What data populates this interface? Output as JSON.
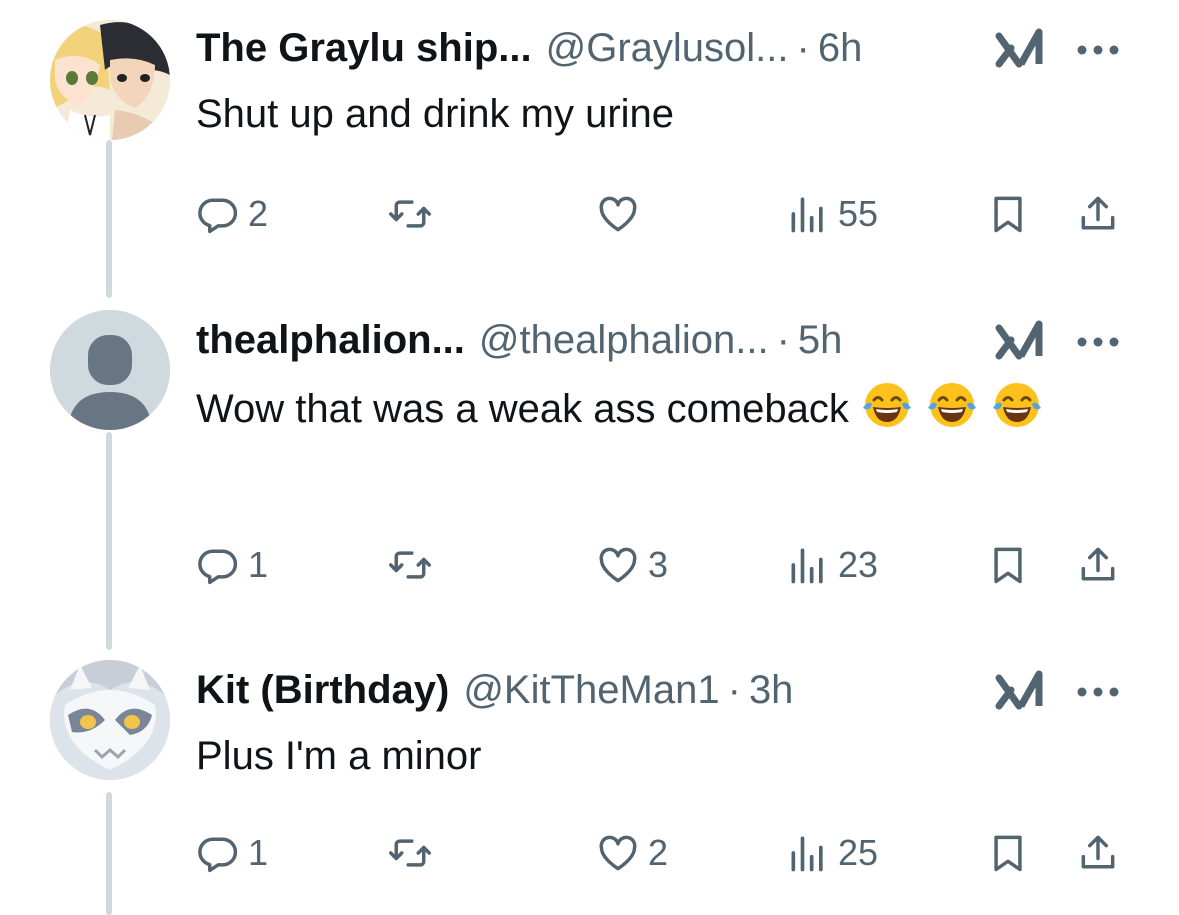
{
  "tweets": [
    {
      "name": "The Graylu ship...",
      "handle": "@Graylusol...",
      "separator": "·",
      "time": "6h",
      "text": "Shut up and drink my urine",
      "emojis": [],
      "avatar": "anime-couple-avatar",
      "replies": "2",
      "retweets": "",
      "likes": "",
      "views": "55"
    },
    {
      "name": "thealphalion...",
      "handle": "@thealphalion...",
      "separator": "·",
      "time": "5h",
      "text": "Wow that was a weak ass comeback",
      "emojis": [
        "😂",
        "😂",
        "😂"
      ],
      "avatar": "default-person-avatar",
      "replies": "1",
      "retweets": "",
      "likes": "3",
      "views": "23"
    },
    {
      "name": "Kit (Birthday)",
      "handle": "@KitTheMan1",
      "separator": "·",
      "time": "3h",
      "text": "Plus I'm a minor",
      "emojis": [],
      "avatar": "white-creature-avatar",
      "replies": "1",
      "retweets": "",
      "likes": "2",
      "views": "25"
    }
  ],
  "colors": {
    "primary_text": "#0f1419",
    "secondary_text": "#536471",
    "thread_line": "#cfd9de",
    "default_avatar_bg": "#cfd9de",
    "default_avatar_fg": "#687684",
    "emoji_face": "#fcc21b"
  },
  "icons": [
    "reply-icon",
    "retweet-icon",
    "like-icon",
    "views-icon",
    "bookmark-icon",
    "share-icon",
    "grok-icon",
    "more-icon"
  ]
}
